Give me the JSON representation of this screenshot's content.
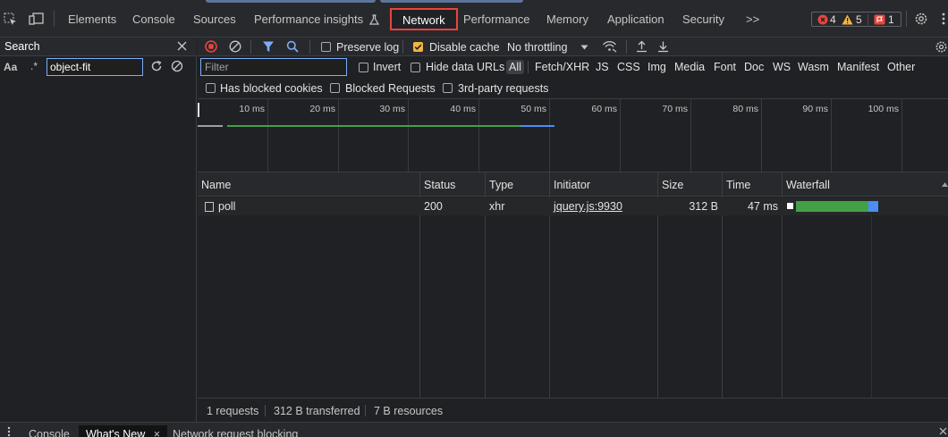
{
  "toolbar_tabs": [
    {
      "label": "Elements"
    },
    {
      "label": "Console"
    },
    {
      "label": "Sources"
    },
    {
      "label": "Performance insights"
    },
    {
      "label": "Network"
    },
    {
      "label": "Performance"
    },
    {
      "label": "Memory"
    },
    {
      "label": "Application"
    },
    {
      "label": "Security"
    }
  ],
  "more_tabs": ">>",
  "issues": {
    "errors": "4",
    "warnings": "5",
    "issues": "1"
  },
  "colors": {
    "accent": "#8ab4f8",
    "active_outline": "#e8453c",
    "record": "#e8453c",
    "checkbox": "#f2b540",
    "bar_green": "#43a047",
    "bar_blue": "#1a73e8"
  },
  "search": {
    "title": "Search",
    "case_label": "Aa",
    "regex_label": ".*",
    "value": "object-fit"
  },
  "network_toolbar": {
    "preserve_log": "Preserve log",
    "disable_cache": "Disable cache",
    "throttling": "No throttling"
  },
  "filter": {
    "placeholder": "Filter",
    "invert": "Invert",
    "hide_data_urls": "Hide data URLs",
    "types": [
      "All",
      "Fetch/XHR",
      "JS",
      "CSS",
      "Img",
      "Media",
      "Font",
      "Doc",
      "WS",
      "Wasm",
      "Manifest",
      "Other"
    ],
    "has_blocked_cookies": "Has blocked cookies",
    "blocked_requests": "Blocked Requests",
    "third_party": "3rd-party requests"
  },
  "timeline_ticks": [
    "10 ms",
    "20 ms",
    "30 ms",
    "40 ms",
    "50 ms",
    "60 ms",
    "70 ms",
    "80 ms",
    "90 ms",
    "100 ms"
  ],
  "columns": {
    "name": "Name",
    "status": "Status",
    "type": "Type",
    "initiator": "Initiator",
    "size": "Size",
    "time": "Time",
    "waterfall": "Waterfall"
  },
  "requests": [
    {
      "name": "poll",
      "status": "200",
      "type": "xhr",
      "initiator": "jquery.js:9930",
      "size": "312 B",
      "time": "47 ms"
    }
  ],
  "summary": {
    "requests": "1 requests",
    "transferred": "312 B transferred",
    "resources": "7 B resources"
  },
  "drawer_tabs": [
    {
      "label": "Console"
    },
    {
      "label": "What's New"
    },
    {
      "label": "Network request blocking"
    }
  ]
}
